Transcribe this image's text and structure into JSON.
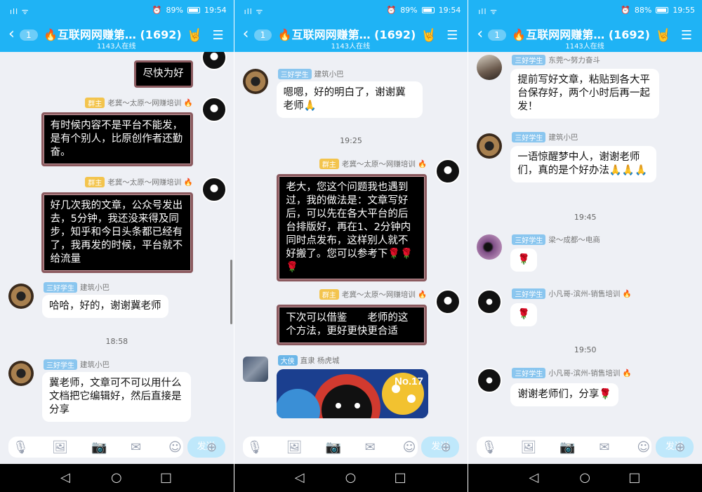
{
  "panels": [
    {
      "status": {
        "signal": "ıll ᯤ",
        "battery": "89%",
        "time": "19:54"
      },
      "header": {
        "badge": "1",
        "title": "🔥互联网网赚第… (1692)",
        "online": "1143人在线"
      },
      "messages": [
        {
          "text": "尽快为好"
        },
        {
          "tag": "群主",
          "name": "老冀～太原～网赚培训 🔥",
          "text": "有时候内容不是平台不能发，是有个别人，比原创作者还勤奋。"
        },
        {
          "tag": "群主",
          "name": "老冀～太原～网赚培训 🔥",
          "text": "好几次我的文章，公众号发出去，5分钟，我还没来得及同步，知乎和今日头条都已经有了，我再发的时候，平台就不给流量"
        },
        {
          "tag": "三好学生",
          "name": "建筑小巴",
          "text": "哈哈，好的，谢谢冀老师"
        },
        {
          "time": "18:58"
        },
        {
          "tag": "三好学生",
          "name": "建筑小巴",
          "text": "冀老师，文章可不可以用什么文档把它编辑好，然后直接是分享"
        }
      ],
      "input": {
        "send": "发送"
      }
    },
    {
      "status": {
        "signal": "ıll ᯤ",
        "battery": "89%",
        "time": "19:54"
      },
      "header": {
        "badge": "1",
        "title": "🔥互联网网赚第… (1692)",
        "online": "1143人在线"
      },
      "messages": [
        {
          "tag": "三好学生",
          "name": "建筑小巴",
          "text": "嗯嗯，好的明白了，谢谢冀老师🙏"
        },
        {
          "time": "19:25"
        },
        {
          "tag": "群主",
          "name": "老冀～太原～网赚培训 🔥",
          "text": "老大，您这个问题我也遇到过，我的做法是：文章写好后，可以先在各大平台的后台排版好，再在1、2分钟内同时点发布，这样别人就不好搬了。您可以参考下🌹🌹🌹"
        },
        {
          "tag": "群主",
          "name": "老冀～太原～网赚培训 🔥",
          "text": "下次可以借鉴　　老师的这个方法，更好更快更合适"
        },
        {
          "tag": "大侠",
          "name": "直隶 杨虎城",
          "img_label": "No.17"
        }
      ],
      "input": {
        "send": "发送"
      }
    },
    {
      "status": {
        "signal": "ıll ᯤ",
        "battery": "88%",
        "time": "19:55"
      },
      "header": {
        "badge": "1",
        "title": "🔥互联网网赚第… (1692)",
        "online": "1143人在线"
      },
      "messages": [
        {
          "tag": "三好学生",
          "name": "东莞～努力奋斗",
          "text": "提前写好文章，粘贴到各大平台保存好，两个小时后再一起发！"
        },
        {
          "tag": "三好学生",
          "name": "建筑小巴",
          "text": "一语惊醒梦中人，谢谢老师们，真的是个好办法🙏🙏🙏"
        },
        {
          "time": "19:45"
        },
        {
          "tag": "三好学生",
          "name": "梁～成都～电商",
          "text": "🌹"
        },
        {
          "tag": "三好学生",
          "name": "小凡哥-滨州-销售培训 🔥",
          "text": "🌹"
        },
        {
          "time": "19:50"
        },
        {
          "tag": "三好学生",
          "name": "小凡哥-滨州-销售培训 🔥",
          "text": "谢谢老师们，分享🌹"
        }
      ],
      "input": {
        "send": "发送"
      }
    }
  ],
  "icons": {
    "back": "chevron-left-icon",
    "ear": "ear-icon",
    "rock": "rock-hand-icon",
    "menu": "menu-icon",
    "mic": "mic-icon",
    "image": "image-icon",
    "camera": "camera-icon",
    "redpacket": "red-packet-icon",
    "emoji": "emoji-icon",
    "plus": "plus-icon"
  },
  "nav": {
    "back": "◁",
    "home": "○",
    "recent": "□"
  }
}
